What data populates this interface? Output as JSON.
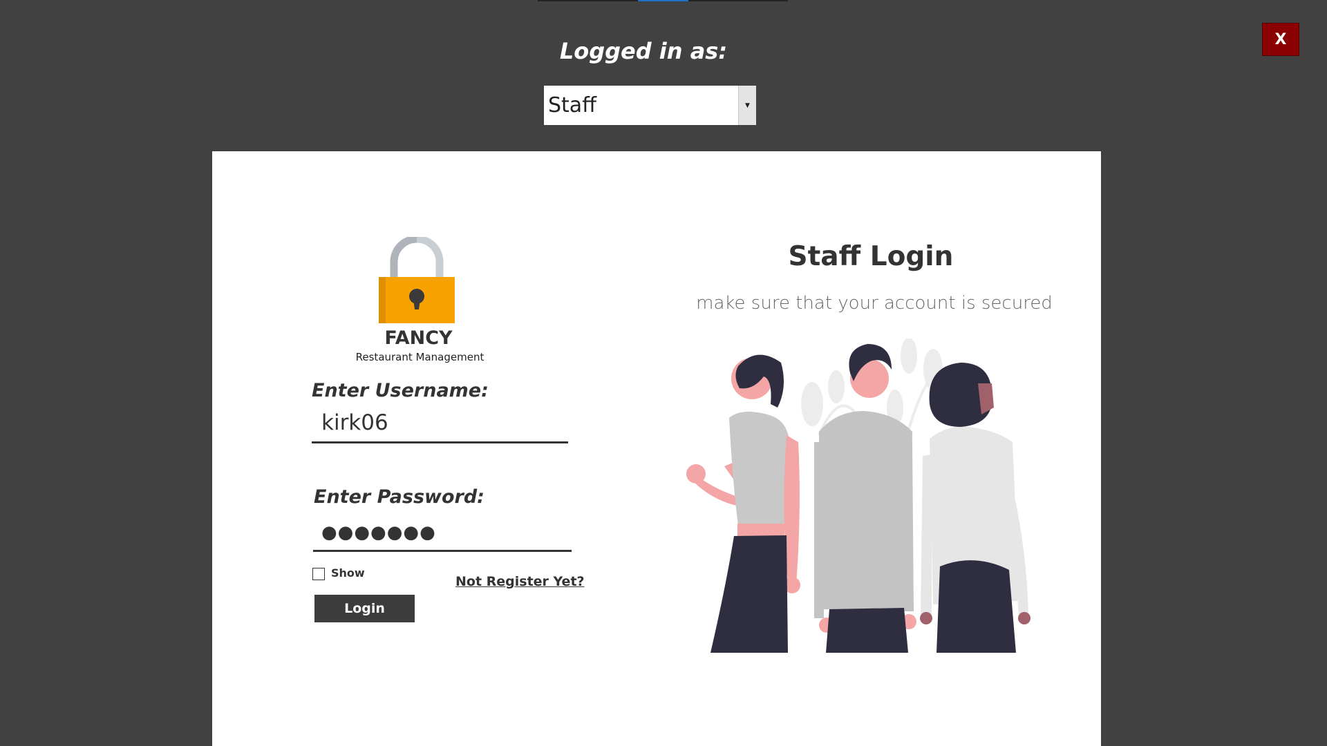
{
  "window": {
    "close_label": "X"
  },
  "header": {
    "logged_in_label": "Logged in as:",
    "role_selected": "Staff"
  },
  "brand": {
    "name": "FANCY",
    "subtitle": "Restaurant Management"
  },
  "form": {
    "username_label": "Enter Username:",
    "username_value": "kirk06",
    "password_label": "Enter Password:",
    "password_mask": "●●●●●●●",
    "show_label": "Show",
    "register_link": "Not Register Yet?",
    "login_button": "Login"
  },
  "panel": {
    "title": "Staff Login",
    "subtitle": "make sure that your account is secured"
  },
  "icons": {
    "lock": "padlock-icon",
    "dropdown": "chevron-down-icon",
    "illustration": "people-illustration"
  },
  "colors": {
    "background": "#414141",
    "close_button": "#8b0000",
    "lock_body": "#f7a200",
    "accent_tab": "#1e73c8",
    "button": "#3c3c3c"
  }
}
